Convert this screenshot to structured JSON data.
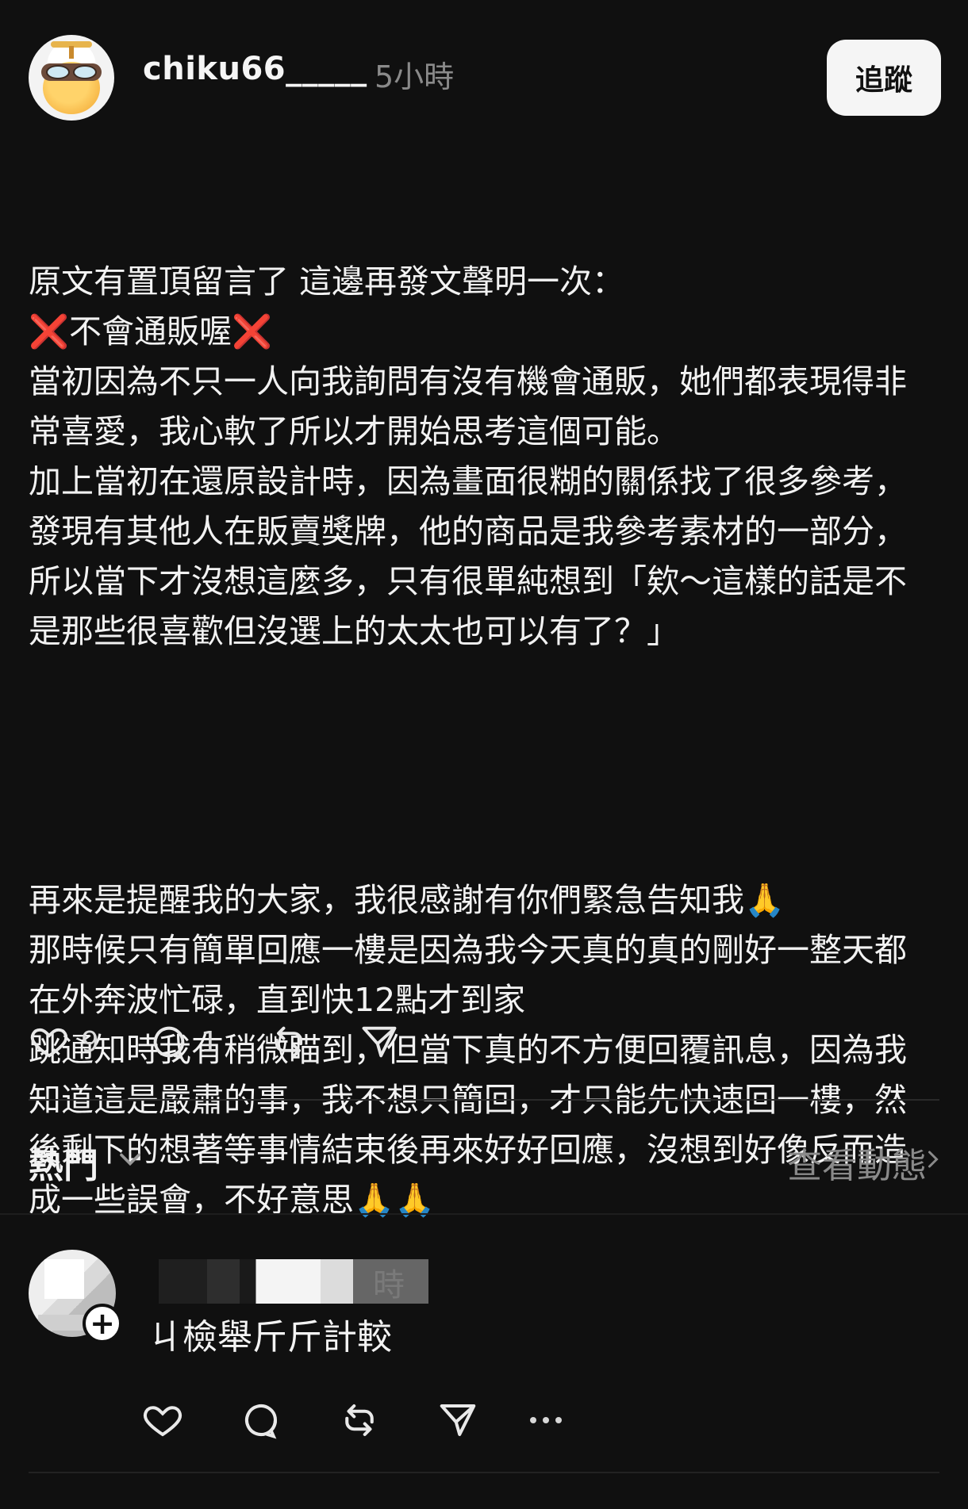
{
  "post": {
    "username": "chiku66_____",
    "time": "5小時",
    "follow_label": "追蹤",
    "paragraph1": "原文有置頂留言了 這邊再發文聲明一次：\n❌不會通販喔❌\n當初因為不只一人向我詢問有沒有機會通販，她們都表現得非常喜愛，我心軟了所以才開始思考這個可能。\n加上當初在還原設計時，因為畫面很糊的關係找了很多參考，發現有其他人在販賣獎牌，他的商品是我參考素材的一部分，所以當下才沒想這麼多，只有很單純想到「欸～這樣的話是不是那些很喜歡但沒選上的太太也可以有了？」",
    "paragraph2": "再來是提醒我的大家，我很感謝有你們緊急告知我🙏\n那時候只有簡單回應一樓是因為我今天真的真的剛好一整天都在外奔波忙碌，直到快12點才到家\n跳通知時我有稍微瞄到，但當下真的不方便回覆訊息，因為我知道這是嚴肅的事，我不想只簡回，才只能先快速回一樓，然後剩下的想著等事情結束後再來好好回應，沒想到好像反而造成一些誤會，不好意思🙏🙏",
    "like_count": "9",
    "comment_count": "1"
  },
  "sort": {
    "label": "熱門",
    "activity_label": "查看動態"
  },
  "reply": {
    "time_fragment": "時",
    "text": "ㄐ檢舉斤斤計較"
  },
  "icons": {
    "like": "heart-icon",
    "comment": "comment-icon",
    "repost": "repost-icon",
    "share": "send-icon",
    "chevron_down": "chevron-down-icon",
    "chevron_right": "chevron-right-icon",
    "more": "more-icon",
    "add": "plus-icon"
  }
}
